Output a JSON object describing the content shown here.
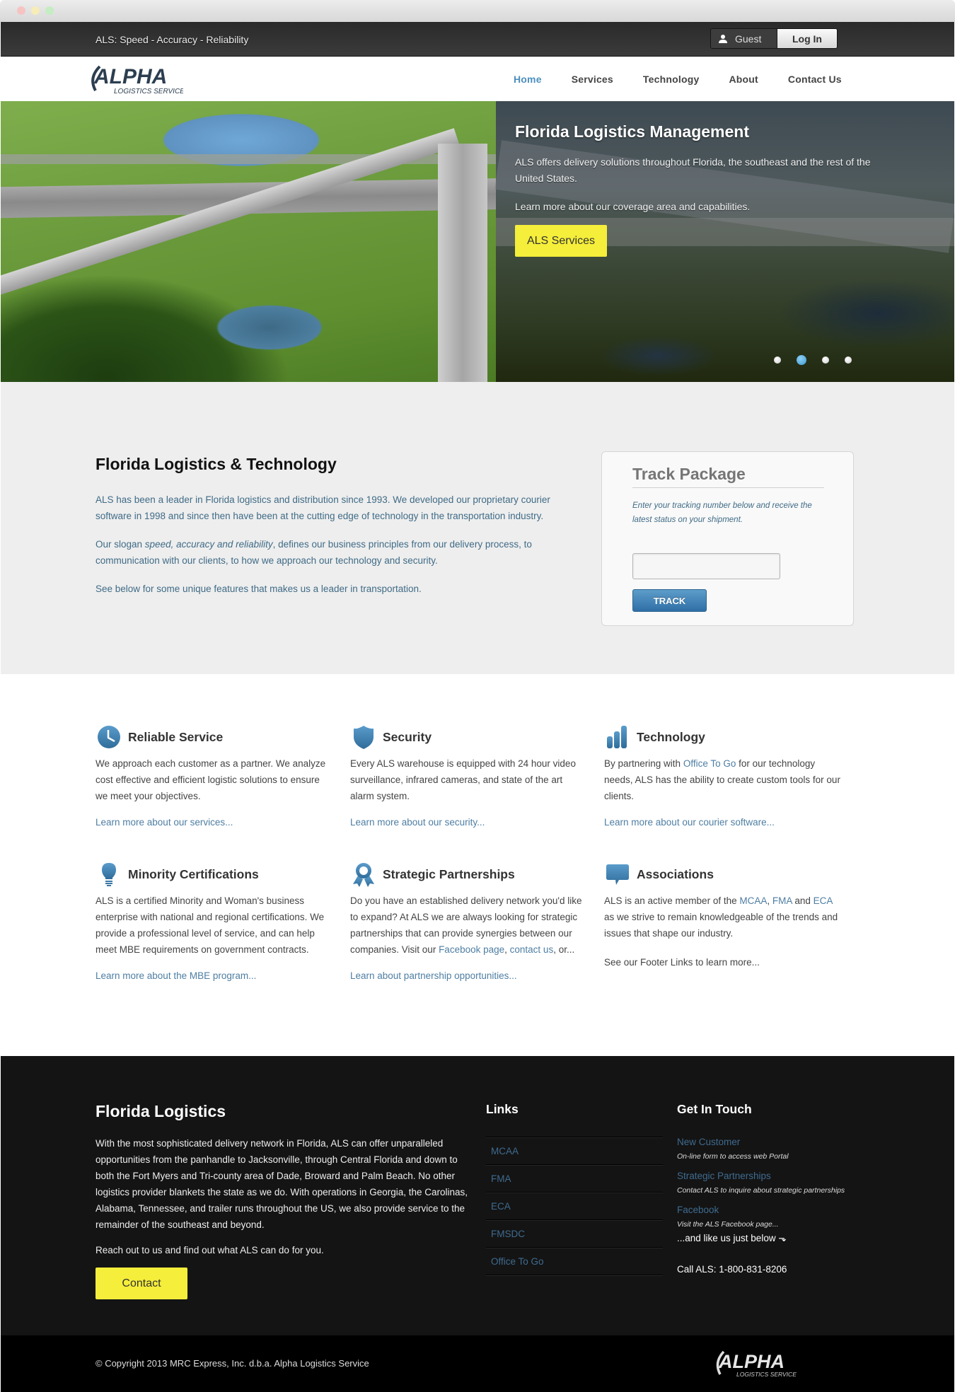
{
  "topbar": {
    "tagline": "ALS: Speed - Accuracy - Reliability",
    "guest_label": "Guest",
    "login_label": "Log In"
  },
  "logo": {
    "main": "ALPHA",
    "sub": "LOGISTICS SERVICE"
  },
  "nav": {
    "items": [
      {
        "label": "Home",
        "active": true
      },
      {
        "label": "Services"
      },
      {
        "label": "Technology"
      },
      {
        "label": "About"
      },
      {
        "label": "Contact Us"
      }
    ]
  },
  "hero": {
    "title": "Florida Logistics Management",
    "text1": "ALS offers delivery solutions throughout Florida, the southeast and the rest of the United States.",
    "text2": "Learn more about our coverage area and capabilities.",
    "button": "ALS Services",
    "slides_total": 4,
    "active_slide": 2
  },
  "intro": {
    "title": "Florida Logistics & Technology",
    "p1": "ALS has been a leader in Florida logistics and distribution since 1993. We developed our proprietary courier software in 1998 and since then have been at the cutting edge of technology in the transportation industry.",
    "p2_prefix": "Our slogan ",
    "p2_em": "speed, accuracy and reliability",
    "p2_mid": ", defines ",
    "p2_link": "our business principles",
    "p2_suffix": " from our delivery process, to communication with our clients, to how we approach our technology and security.",
    "p3": "See below for some unique features that makes us a leader in transportation."
  },
  "track": {
    "title": "Track Package",
    "description": "Enter your tracking number below and receive the latest status on your shipment.",
    "input_value": "",
    "input_placeholder": "",
    "button": "TRACK"
  },
  "features": [
    {
      "icon": "clock-icon",
      "title": "Reliable Service",
      "body": "We approach each customer as a partner. We analyze cost effective and efficient logistic solutions to ensure we meet your objectives.",
      "link": "Learn more about our services..."
    },
    {
      "icon": "shield-icon",
      "title": "Security",
      "body": "Every ALS warehouse is equipped with 24 hour video surveillance, infrared cameras, and state of the art alarm system.",
      "link": "Learn more about our security..."
    },
    {
      "icon": "bar-chart-icon",
      "title": "Technology",
      "body_prefix": "By partnering with ",
      "body_link": "Office To Go",
      "body_suffix": " for our technology needs, ALS has the ability to create custom tools for our clients.",
      "link": "Learn more about our courier software..."
    },
    {
      "icon": "lightbulb-icon",
      "title": "Minority Certifications",
      "body": "ALS is a certified Minority and Woman's business enterprise with national and regional certifications. We provide a professional level of service, and can help meet MBE requirements on government contracts.",
      "link": "Learn more about the MBE program..."
    },
    {
      "icon": "ribbon-award-icon",
      "title": "Strategic Partnerships",
      "body_prefix": "Do you have an established delivery network you'd like to expand? At ALS we are always looking for strategic partnerships that can provide synergies between our companies. Visit our ",
      "body_link1": "Facebook page",
      "body_mid": ", ",
      "body_link2": "contact us",
      "body_suffix": ", or...",
      "link": "Learn about partnership opportunities..."
    },
    {
      "icon": "speech-bubble-icon",
      "title": "Associations",
      "body_prefix": "ALS is an active member of the ",
      "body_link1": "MCAA",
      "body_sep1": ", ",
      "body_link2": "FMA",
      "body_sep2": " and ",
      "body_link3": "ECA",
      "body_suffix": " as we strive to remain knowledgeable of the trends and issues that shape our industry.",
      "footer_note": "See our Footer Links to learn more..."
    }
  ],
  "footer": {
    "about_title": "Florida Logistics",
    "about_text": "With the most sophisticated delivery network in Florida, ALS can offer unparalleled opportunities from the panhandle to Jacksonville, through Central Florida and down to both the Fort Myers and Tri-county area of Dade, Broward and Palm Beach. No other logistics provider blankets the state as we do. With operations in Georgia, the Carolinas, Alabama, Tennessee, and trailer runs throughout the US, we also provide service to the remainder of the southeast and beyond.",
    "reach_text": "Reach out to us and find out what ALS can do for you.",
    "contact_button": "Contact",
    "links_title": "Links",
    "links": [
      "MCAA",
      "FMA",
      "ECA",
      "FMSDC",
      "Office To Go"
    ],
    "touch_title": "Get In Touch",
    "touch_items": [
      {
        "label": "New Customer",
        "desc": "On-line form to access web Portal"
      },
      {
        "label": "Strategic Partnerships",
        "desc": "Contact ALS to inquire about strategic partnerships"
      },
      {
        "label": "Facebook",
        "desc": "Visit the ALS Facebook page..."
      }
    ],
    "like_text": "...and like us just below ⬎",
    "call_text": "Call ALS: 1-800-831-8206"
  },
  "bottombar": {
    "copyright": "© Copyright 2013 MRC Express, Inc. d.b.a. Alpha Logistics Service"
  },
  "colors": {
    "accent_blue": "#4d8fbf",
    "link_blue": "#3f6b86",
    "button_yellow": "#f5ee3a",
    "footer_bg": "#141414"
  }
}
